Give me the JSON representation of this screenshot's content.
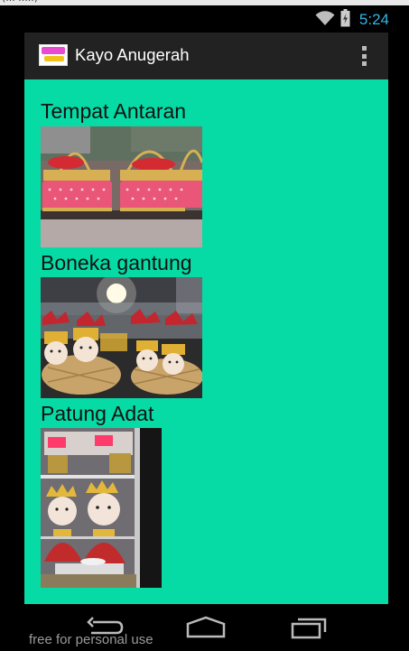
{
  "top_strip": {
    "text": "(... .....)"
  },
  "status_bar": {
    "time": "5:24",
    "accent_color": "#33b5e5"
  },
  "action_bar": {
    "title": "Kayo Anugerah",
    "logo": "kayo-anugerah-logo",
    "menu_icon": "overflow-menu-icon"
  },
  "content": {
    "background": "#06dba6",
    "items": [
      {
        "label": "Tempat Antaran",
        "image": "gift-baskets-photo"
      },
      {
        "label": "Boneka gantung",
        "image": "hanging-dolls-photo"
      },
      {
        "label": "Patung Adat",
        "image": "traditional-figurines-photo"
      }
    ]
  },
  "nav_bar": {
    "buttons": [
      "back-icon",
      "home-icon",
      "recent-apps-icon"
    ]
  },
  "watermark": "free for personal use"
}
